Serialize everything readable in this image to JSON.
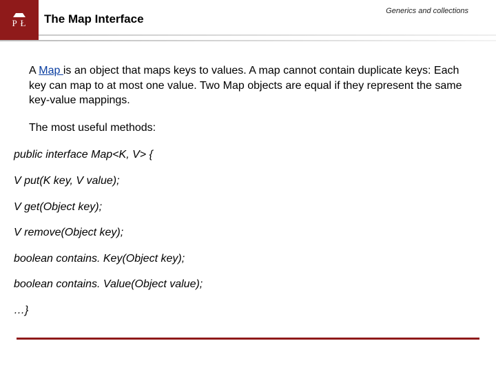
{
  "colors": {
    "brand": "#8f1a1a",
    "link": "#0a3ea0"
  },
  "logo": {
    "line1": "P   Ł"
  },
  "header": {
    "topic": "Generics and collections",
    "title": "The Map Interface"
  },
  "body": {
    "para1_pre": "A ",
    "para1_link": "Map ",
    "para1_post": "is an object that maps keys to values. A map cannot contain duplicate keys: Each key can map to at most one value. Two ",
    "para1_mono": "Map",
    "para1_tail": " objects are equal if they represent the same key-value mappings.",
    "para2": "The most useful methods:",
    "sig": "public interface Map<K, V> {",
    "m1": "V put(K key, V value);",
    "m2": "V get(Object key);",
    "m3": "V remove(Object key);",
    "m4": "boolean contains. Key(Object key);",
    "m5": "boolean contains. Value(Object value);",
    "mend": "…}"
  }
}
